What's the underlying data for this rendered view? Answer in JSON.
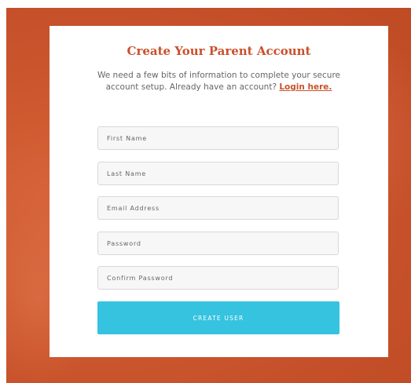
{
  "form": {
    "title": "Create Your Parent Account",
    "subtitle_text": "We need a few bits of information to complete your secure account setup. Already have an account? ",
    "login_link": "Login here.",
    "fields": {
      "first_name": {
        "placeholder": "First Name",
        "value": ""
      },
      "last_name": {
        "placeholder": "Last Name",
        "value": ""
      },
      "email": {
        "placeholder": "Email Address",
        "value": ""
      },
      "password": {
        "placeholder": "Password",
        "value": ""
      },
      "confirm_password": {
        "placeholder": "Confirm Password",
        "value": ""
      }
    },
    "submit_label": "CREATE USER"
  },
  "colors": {
    "background_accent": "#c9552c",
    "title": "#c9512b",
    "button": "#35c3e0",
    "card": "#ffffff"
  }
}
